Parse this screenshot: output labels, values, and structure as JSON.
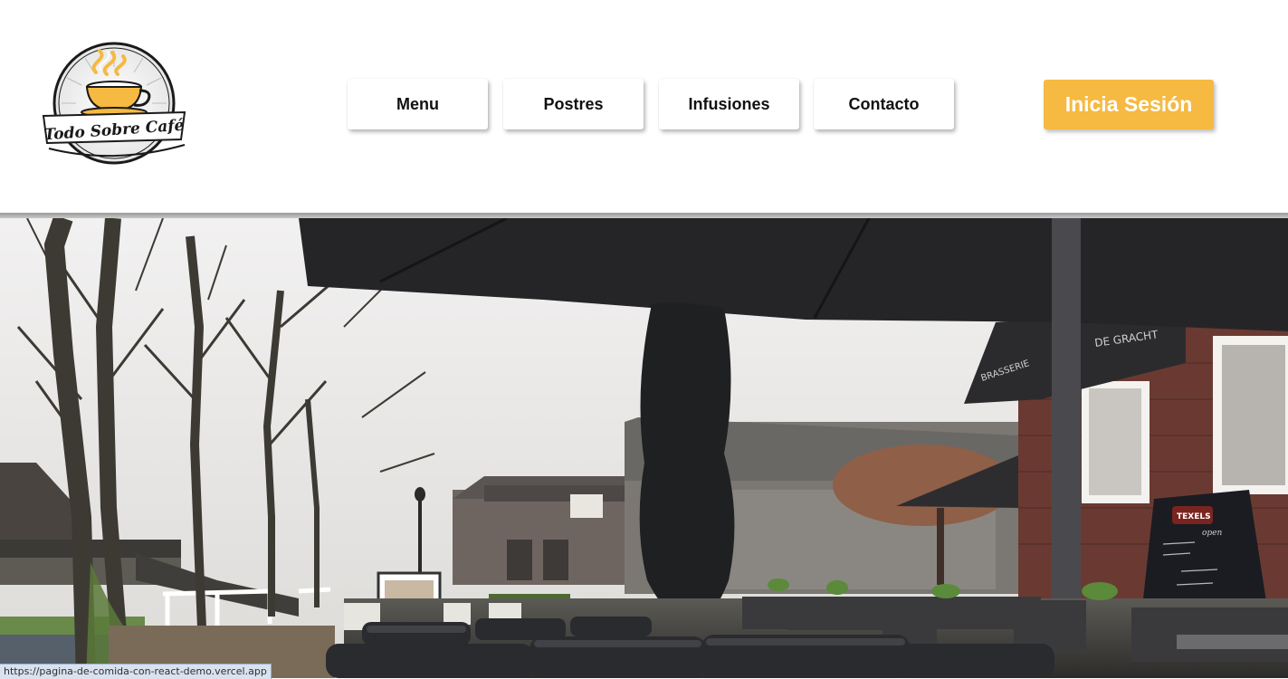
{
  "header": {
    "logo": {
      "text": "Todo Sobre Café",
      "icon": "coffee-cup-icon"
    },
    "nav": [
      {
        "label": "Menu"
      },
      {
        "label": "Postres"
      },
      {
        "label": "Infusiones"
      },
      {
        "label": "Contacto"
      }
    ],
    "login_label": "Inicia Sesión"
  },
  "hero": {
    "description_icon": "cafe-terrace-photo",
    "sign_texts": {
      "brasserie": "BRASSERIE",
      "gracht": "DE GRACHT",
      "texels": "TEXELS",
      "open": "open"
    }
  },
  "status_bar": {
    "url": "https://pagina-de-comida-con-react-demo.vercel.app"
  },
  "colors": {
    "accent": "#f6b941",
    "nav_text": "#111111",
    "login_text": "#ffffff"
  }
}
